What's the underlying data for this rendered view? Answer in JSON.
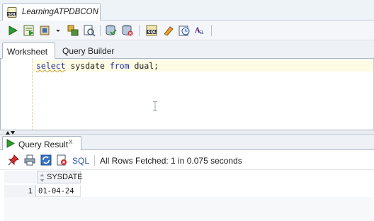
{
  "document_tab": {
    "title": "LearningATPDBCON",
    "icon": "sql-file-icon"
  },
  "toolbar": {
    "buttons": [
      "run-statement-icon",
      "run-script-icon",
      "autotrace-icon",
      "dropdown-arrow-icon",
      "explain-plan-icon",
      "sql-tuning-icon",
      "commit-icon",
      "rollback-icon",
      "unshared-sql-icon",
      "clear-icon",
      "history-icon",
      "format-icon"
    ]
  },
  "subtabs": {
    "worksheet": "Worksheet",
    "query_builder": "Query Builder"
  },
  "editor": {
    "tokens": [
      {
        "text": "select",
        "type": "keyword"
      },
      {
        "text": " sysdate ",
        "type": "plain"
      },
      {
        "text": "from",
        "type": "keyword"
      },
      {
        "text": " dual;",
        "type": "plain"
      }
    ]
  },
  "results": {
    "tab_label": "Query Result",
    "tab_close": "x",
    "sql_link": "SQL",
    "status": "All Rows Fetched: 1 in 0.075 seconds",
    "columns": [
      "SYSDATE"
    ],
    "rows": [
      {
        "num": "1",
        "cells": [
          "01-04-24"
        ]
      }
    ]
  },
  "colors": {
    "keyword": "#1f2aa8",
    "current_line": "#fdfbe3",
    "link": "#2b55a6"
  }
}
